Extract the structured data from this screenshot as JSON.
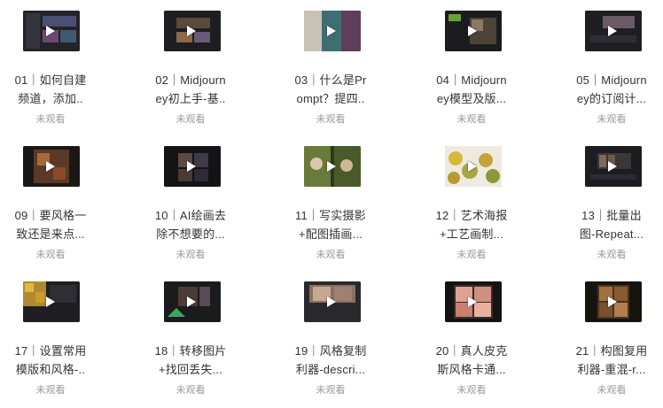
{
  "videos": [
    {
      "line1": "01｜如何自建",
      "line2": "频道，添加..",
      "status": "未观看"
    },
    {
      "line1": "02｜Midjourn",
      "line2": "ey初上手-基..",
      "status": "未观看"
    },
    {
      "line1": "03｜什么是Pr",
      "line2": "ompt？提四..",
      "status": "未观看"
    },
    {
      "line1": "04｜Midjourn",
      "line2": "ey模型及版...",
      "status": "未观看"
    },
    {
      "line1": "05｜Midjourn",
      "line2": "ey的订阅计...",
      "status": "未观看"
    },
    {
      "line1": "09｜要风格一",
      "line2": "致还是来点...",
      "status": "未观看"
    },
    {
      "line1": "10｜AI绘画去",
      "line2": "除不想要的...",
      "status": "未观看"
    },
    {
      "line1": "11｜写实摄影",
      "line2": "+配图插画...",
      "status": "未观看"
    },
    {
      "line1": "12｜艺术海报",
      "line2": "+工艺画制...",
      "status": "未观看"
    },
    {
      "line1": "13｜批量出",
      "line2": "图-Repeat...",
      "status": "未观看"
    },
    {
      "line1": "17｜设置常用",
      "line2": "模版和风格-..",
      "status": "未观看"
    },
    {
      "line1": "18｜转移图片",
      "line2": "+找回丢失...",
      "status": "未观看"
    },
    {
      "line1": "19｜风格复制",
      "line2": "利器-descri...",
      "status": "未观看"
    },
    {
      "line1": "20｜真人皮克",
      "line2": "斯风格卡通...",
      "status": "未观看"
    },
    {
      "line1": "21｜构图复用",
      "line2": "利器-重混-r...",
      "status": "未观看"
    }
  ]
}
